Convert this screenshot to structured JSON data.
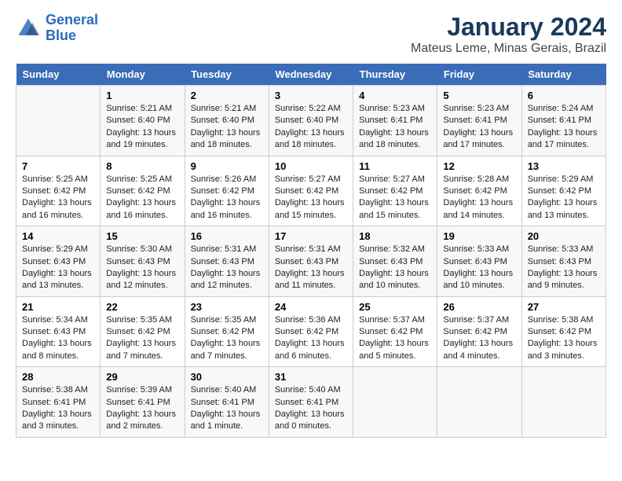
{
  "header": {
    "logo_line1": "General",
    "logo_line2": "Blue",
    "main_title": "January 2024",
    "subtitle": "Mateus Leme, Minas Gerais, Brazil"
  },
  "days": [
    "Sunday",
    "Monday",
    "Tuesday",
    "Wednesday",
    "Thursday",
    "Friday",
    "Saturday"
  ],
  "weeks": [
    [
      {
        "date": "",
        "info": ""
      },
      {
        "date": "1",
        "info": "Sunrise: 5:21 AM\nSunset: 6:40 PM\nDaylight: 13 hours\nand 19 minutes."
      },
      {
        "date": "2",
        "info": "Sunrise: 5:21 AM\nSunset: 6:40 PM\nDaylight: 13 hours\nand 18 minutes."
      },
      {
        "date": "3",
        "info": "Sunrise: 5:22 AM\nSunset: 6:40 PM\nDaylight: 13 hours\nand 18 minutes."
      },
      {
        "date": "4",
        "info": "Sunrise: 5:23 AM\nSunset: 6:41 PM\nDaylight: 13 hours\nand 18 minutes."
      },
      {
        "date": "5",
        "info": "Sunrise: 5:23 AM\nSunset: 6:41 PM\nDaylight: 13 hours\nand 17 minutes."
      },
      {
        "date": "6",
        "info": "Sunrise: 5:24 AM\nSunset: 6:41 PM\nDaylight: 13 hours\nand 17 minutes."
      }
    ],
    [
      {
        "date": "7",
        "info": "Sunrise: 5:25 AM\nSunset: 6:42 PM\nDaylight: 13 hours\nand 16 minutes."
      },
      {
        "date": "8",
        "info": "Sunrise: 5:25 AM\nSunset: 6:42 PM\nDaylight: 13 hours\nand 16 minutes."
      },
      {
        "date": "9",
        "info": "Sunrise: 5:26 AM\nSunset: 6:42 PM\nDaylight: 13 hours\nand 16 minutes."
      },
      {
        "date": "10",
        "info": "Sunrise: 5:27 AM\nSunset: 6:42 PM\nDaylight: 13 hours\nand 15 minutes."
      },
      {
        "date": "11",
        "info": "Sunrise: 5:27 AM\nSunset: 6:42 PM\nDaylight: 13 hours\nand 15 minutes."
      },
      {
        "date": "12",
        "info": "Sunrise: 5:28 AM\nSunset: 6:42 PM\nDaylight: 13 hours\nand 14 minutes."
      },
      {
        "date": "13",
        "info": "Sunrise: 5:29 AM\nSunset: 6:42 PM\nDaylight: 13 hours\nand 13 minutes."
      }
    ],
    [
      {
        "date": "14",
        "info": "Sunrise: 5:29 AM\nSunset: 6:43 PM\nDaylight: 13 hours\nand 13 minutes."
      },
      {
        "date": "15",
        "info": "Sunrise: 5:30 AM\nSunset: 6:43 PM\nDaylight: 13 hours\nand 12 minutes."
      },
      {
        "date": "16",
        "info": "Sunrise: 5:31 AM\nSunset: 6:43 PM\nDaylight: 13 hours\nand 12 minutes."
      },
      {
        "date": "17",
        "info": "Sunrise: 5:31 AM\nSunset: 6:43 PM\nDaylight: 13 hours\nand 11 minutes."
      },
      {
        "date": "18",
        "info": "Sunrise: 5:32 AM\nSunset: 6:43 PM\nDaylight: 13 hours\nand 10 minutes."
      },
      {
        "date": "19",
        "info": "Sunrise: 5:33 AM\nSunset: 6:43 PM\nDaylight: 13 hours\nand 10 minutes."
      },
      {
        "date": "20",
        "info": "Sunrise: 5:33 AM\nSunset: 6:43 PM\nDaylight: 13 hours\nand 9 minutes."
      }
    ],
    [
      {
        "date": "21",
        "info": "Sunrise: 5:34 AM\nSunset: 6:43 PM\nDaylight: 13 hours\nand 8 minutes."
      },
      {
        "date": "22",
        "info": "Sunrise: 5:35 AM\nSunset: 6:42 PM\nDaylight: 13 hours\nand 7 minutes."
      },
      {
        "date": "23",
        "info": "Sunrise: 5:35 AM\nSunset: 6:42 PM\nDaylight: 13 hours\nand 7 minutes."
      },
      {
        "date": "24",
        "info": "Sunrise: 5:36 AM\nSunset: 6:42 PM\nDaylight: 13 hours\nand 6 minutes."
      },
      {
        "date": "25",
        "info": "Sunrise: 5:37 AM\nSunset: 6:42 PM\nDaylight: 13 hours\nand 5 minutes."
      },
      {
        "date": "26",
        "info": "Sunrise: 5:37 AM\nSunset: 6:42 PM\nDaylight: 13 hours\nand 4 minutes."
      },
      {
        "date": "27",
        "info": "Sunrise: 5:38 AM\nSunset: 6:42 PM\nDaylight: 13 hours\nand 3 minutes."
      }
    ],
    [
      {
        "date": "28",
        "info": "Sunrise: 5:38 AM\nSunset: 6:41 PM\nDaylight: 13 hours\nand 3 minutes."
      },
      {
        "date": "29",
        "info": "Sunrise: 5:39 AM\nSunset: 6:41 PM\nDaylight: 13 hours\nand 2 minutes."
      },
      {
        "date": "30",
        "info": "Sunrise: 5:40 AM\nSunset: 6:41 PM\nDaylight: 13 hours\nand 1 minute."
      },
      {
        "date": "31",
        "info": "Sunrise: 5:40 AM\nSunset: 6:41 PM\nDaylight: 13 hours\nand 0 minutes."
      },
      {
        "date": "",
        "info": ""
      },
      {
        "date": "",
        "info": ""
      },
      {
        "date": "",
        "info": ""
      }
    ]
  ]
}
